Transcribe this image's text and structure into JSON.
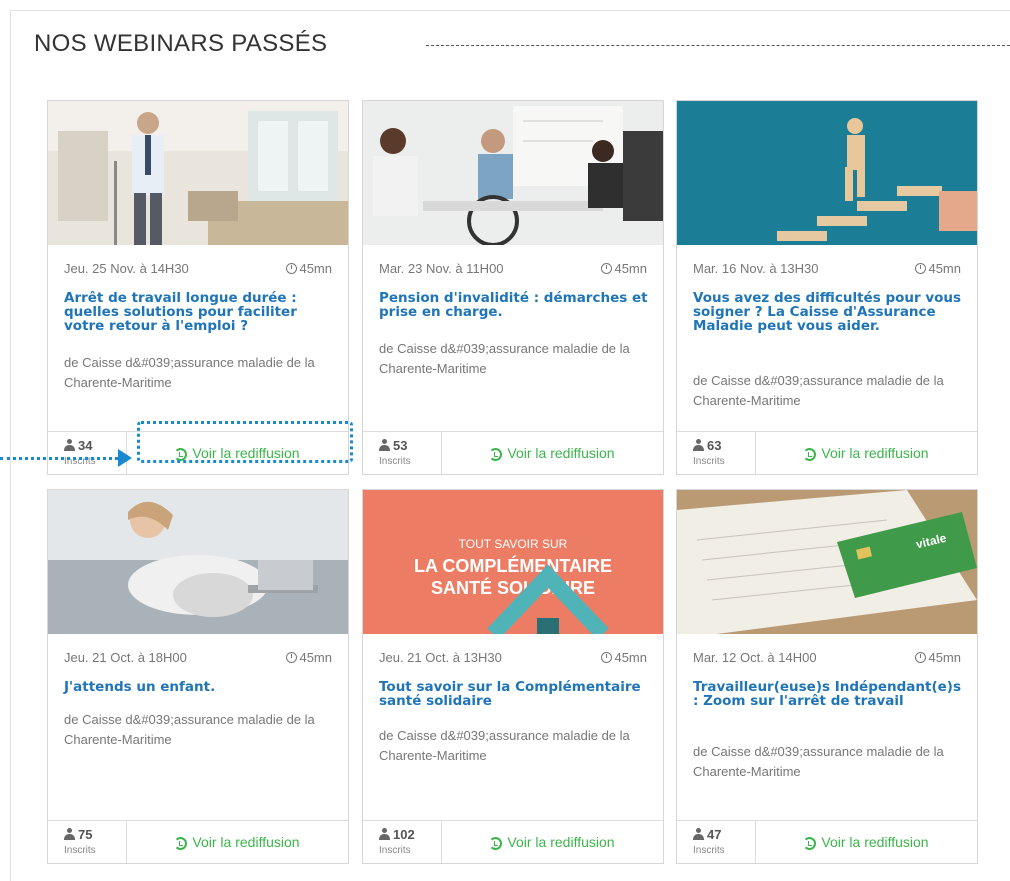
{
  "section_title": "NOS WEBINARS PASSÉS",
  "colors": {
    "title_blue": "#1f75b8",
    "replay_green": "#3cb44b",
    "highlight_blue": "#1a8ad0"
  },
  "replay_label": "Voir la rediffusion",
  "inscrits_label": "Inscrits",
  "cards": [
    {
      "date": "Jeu. 25 Nov. à 14H30",
      "duration": "45mn",
      "title": "Arrêt de travail longue durée : quelles solutions pour faciliter votre retour à l'emploi ?",
      "organizer": "de Caisse d&#039;assurance maladie de la Charente-Maritime",
      "count": "34"
    },
    {
      "date": "Mar. 23 Nov. à 11H00",
      "duration": "45mn",
      "title": "Pension d'invalidité : démarches et prise en charge.",
      "organizer": "de Caisse d&#039;assurance maladie de la Charente-Maritime",
      "count": "53"
    },
    {
      "date": "Mar. 16 Nov. à 13H30",
      "duration": "45mn",
      "title": "Vous avez des difficultés pour vous soigner ? La Caisse d'Assurance Maladie peut vous aider.",
      "organizer": "de Caisse d&#039;assurance maladie de la Charente-Maritime",
      "count": "63"
    },
    {
      "date": "Jeu. 21 Oct. à 18H00",
      "duration": "45mn",
      "title": "J'attends un enfant.",
      "organizer": "de Caisse d&#039;assurance maladie de la Charente-Maritime",
      "count": "75"
    },
    {
      "date": "Jeu. 21 Oct. à 13H30",
      "duration": "45mn",
      "title": "Tout savoir sur la Complémentaire santé solidaire",
      "organizer": "de Caisse d&#039;assurance maladie de la Charente-Maritime",
      "count": "102",
      "banner_small": "TOUT SAVOIR SUR",
      "banner_line1": "LA COMPLÉMENTAIRE",
      "banner_line2": "SANTÉ SOLIDAIRE"
    },
    {
      "date": "Mar. 12 Oct. à 14H00",
      "duration": "45mn",
      "title": "Travailleur(euse)s Indépendant(e)s : Zoom sur l'arrêt de travail",
      "organizer": "de Caisse d&#039;assurance maladie de la Charente-Maritime",
      "count": "47",
      "card_text": "vitale"
    }
  ]
}
